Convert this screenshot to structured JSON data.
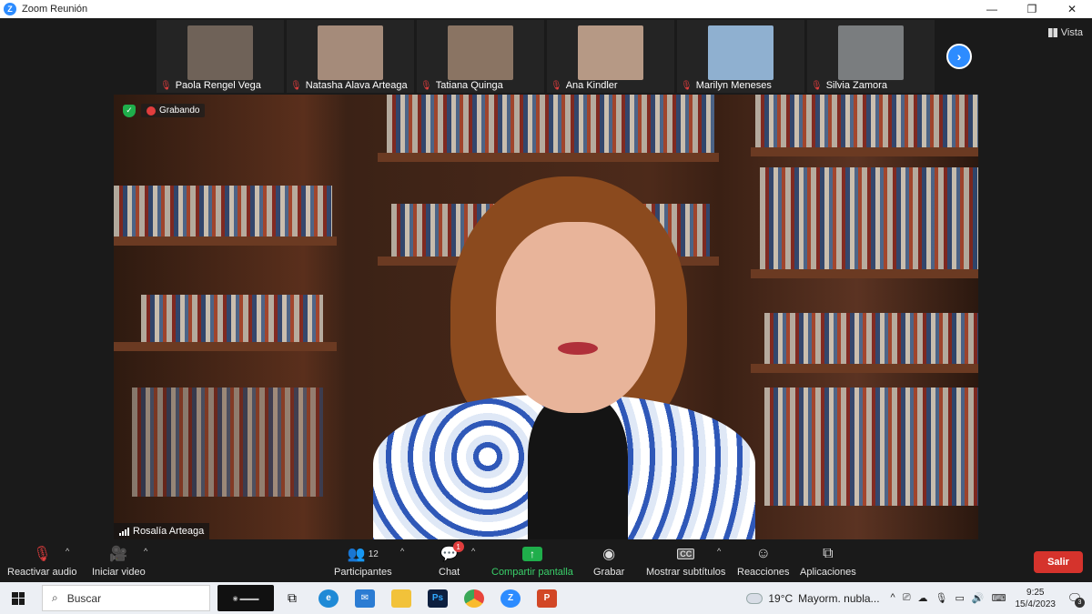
{
  "window": {
    "title": "Zoom Reunión",
    "minimize": "—",
    "restore": "❐",
    "close": "✕"
  },
  "gallery": {
    "participants": [
      {
        "name": "Paola Rengel Vega",
        "tone": "#6f6258"
      },
      {
        "name": "Natasha Alava Arteaga",
        "tone": "#a58b7a"
      },
      {
        "name": "Tatiana Quinga",
        "tone": "#8a7463"
      },
      {
        "name": "Ana Kindler",
        "tone": "#b69985"
      },
      {
        "name": "Marilyn Meneses",
        "tone": "#8fb0d0"
      },
      {
        "name": "Silvia Zamora",
        "tone": "#7a7d7f"
      }
    ],
    "next_page": "›",
    "view_label": "Vista"
  },
  "main_video": {
    "recording_label": "Grabando",
    "speaker_name": "Rosalía Arteaga"
  },
  "toolbar": {
    "unmute_label": "Reactivar audio",
    "start_video_label": "Iniciar video",
    "participants_label": "Participantes",
    "participants_count": "12",
    "chat_label": "Chat",
    "chat_unread": "1",
    "share_label": "Compartir pantalla",
    "record_label": "Grabar",
    "captions_label": "Mostrar subtítulos",
    "captions_icon_text": "CC",
    "reactions_label": "Reacciones",
    "apps_label": "Aplicaciones",
    "leave_label": "Salir",
    "caret": "^"
  },
  "taskbar": {
    "search_label": "Buscar",
    "weather_temp": "19°C",
    "weather_desc": "Mayorm. nubla...",
    "time": "9:25",
    "date": "15/4/2023",
    "notifications": "3",
    "apps": [
      {
        "name": "task-view",
        "label": "",
        "color": "#eceff4",
        "fg": "#333"
      },
      {
        "name": "edge",
        "label": "e",
        "color": "#1f8ad6",
        "fg": "#fff"
      },
      {
        "name": "mail",
        "label": "✉",
        "color": "#2b7cd3",
        "fg": "#fff"
      },
      {
        "name": "explorer",
        "label": "",
        "color": "#f2c23a",
        "fg": "#fff"
      },
      {
        "name": "photoshop",
        "label": "Ps",
        "color": "#0d1f3f",
        "fg": "#31a8ff"
      },
      {
        "name": "chrome",
        "label": "",
        "color": "#e8453c",
        "fg": "#fff"
      },
      {
        "name": "zoom",
        "label": "Z",
        "color": "#2d8cff",
        "fg": "#fff"
      },
      {
        "name": "powerpoint",
        "label": "P",
        "color": "#d24726",
        "fg": "#fff"
      }
    ]
  }
}
